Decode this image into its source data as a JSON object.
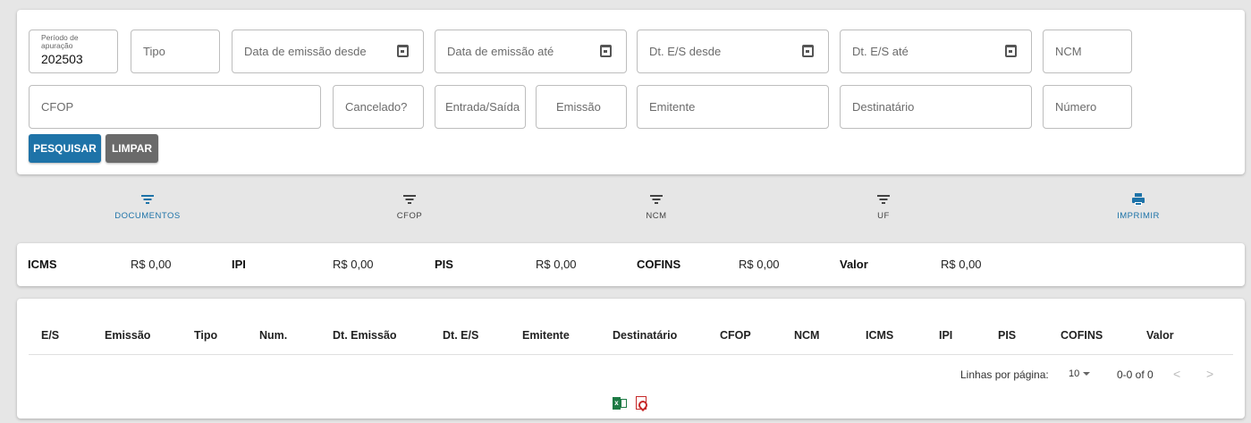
{
  "filters": {
    "periodo": {
      "label": "Período de apuração",
      "value": "202503"
    },
    "tipo": "Tipo",
    "data_emissao_desde": "Data de emissão desde",
    "data_emissao_ate": "Data de emissão até",
    "dt_es_desde": "Dt. E/S desde",
    "dt_es_ate": "Dt. E/S até",
    "ncm": "NCM",
    "cfop": "CFOP",
    "cancelado": "Cancelado?",
    "entrada_saida": "Entrada/Saída",
    "emissao": "Emissão",
    "emitente": "Emitente",
    "destinatario": "Destinatário",
    "numero": "Número",
    "search_label": "PESQUISAR",
    "clear_label": "LIMPAR"
  },
  "tabs": [
    {
      "label": "DOCUMENTOS",
      "icon": "filter-icon",
      "active": true
    },
    {
      "label": "CFOP",
      "icon": "filter-icon",
      "active": false
    },
    {
      "label": "NCM",
      "icon": "filter-icon",
      "active": false
    },
    {
      "label": "UF",
      "icon": "filter-icon",
      "active": false
    },
    {
      "label": "IMPRIMIR",
      "icon": "print-icon",
      "active": true
    }
  ],
  "totals": [
    {
      "label": "ICMS",
      "value": "R$ 0,00"
    },
    {
      "label": "IPI",
      "value": "R$ 0,00"
    },
    {
      "label": "PIS",
      "value": "R$ 0,00"
    },
    {
      "label": "COFINS",
      "value": "R$ 0,00"
    },
    {
      "label": "Valor",
      "value": "R$ 0,00"
    }
  ],
  "table": {
    "columns": [
      "E/S",
      "Emissão",
      "Tipo",
      "Num.",
      "Dt. Emissão",
      "Dt. E/S",
      "Emitente",
      "Destinatário",
      "CFOP",
      "NCM",
      "ICMS",
      "IPI",
      "PIS",
      "COFINS",
      "Valor"
    ],
    "rows": []
  },
  "pagination": {
    "rows_per_page_label": "Linhas por página:",
    "rows_per_page": "10",
    "range": "0-0 of 0",
    "prev": "<",
    "next": ">"
  },
  "colors": {
    "primary": "#1e73a8",
    "secondary": "#6a6a6a",
    "excel": "#1d7a44",
    "pdf": "#c62828"
  }
}
